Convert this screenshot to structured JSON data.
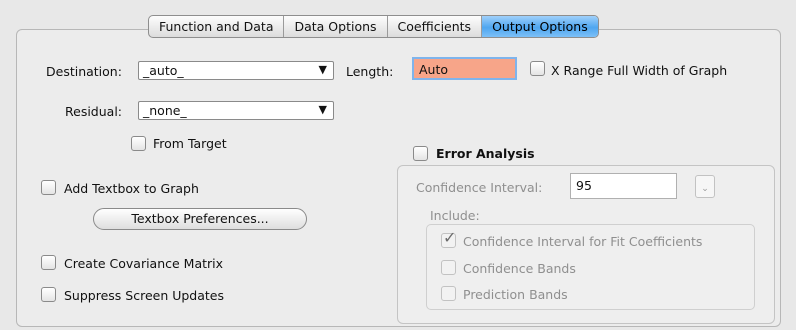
{
  "tabs": [
    {
      "label": "Function and Data",
      "active": false
    },
    {
      "label": "Data Options",
      "active": false
    },
    {
      "label": "Coefficients",
      "active": false
    },
    {
      "label": "Output Options",
      "active": true
    }
  ],
  "destination": {
    "label": "Destination:",
    "value": "_auto_"
  },
  "length": {
    "label": "Length:",
    "value": "Auto",
    "highlight_color": "#f7a589"
  },
  "x_range_full_width": {
    "label": "X Range Full Width of Graph",
    "checked": false
  },
  "residual": {
    "label": "Residual:",
    "value": "_none_"
  },
  "from_target": {
    "label": "From Target",
    "checked": false
  },
  "add_textbox": {
    "label": "Add Textbox to Graph",
    "checked": false
  },
  "textbox_preferences_button": "Textbox Preferences...",
  "create_covariance": {
    "label": "Create Covariance Matrix",
    "checked": false
  },
  "suppress_updates": {
    "label": "Suppress Screen Updates",
    "checked": false
  },
  "error_analysis": {
    "label": "Error Analysis",
    "checked": false,
    "confidence_interval_label": "Confidence Interval:",
    "confidence_interval_value": "95",
    "include_label": "Include:",
    "options": [
      {
        "label": "Confidence Interval for Fit Coefficients",
        "checked": true
      },
      {
        "label": "Confidence Bands",
        "checked": false
      },
      {
        "label": "Prediction Bands",
        "checked": false
      }
    ]
  },
  "colors": {
    "active_tab": "#4ea6f0",
    "length_field": "#f7a589"
  }
}
